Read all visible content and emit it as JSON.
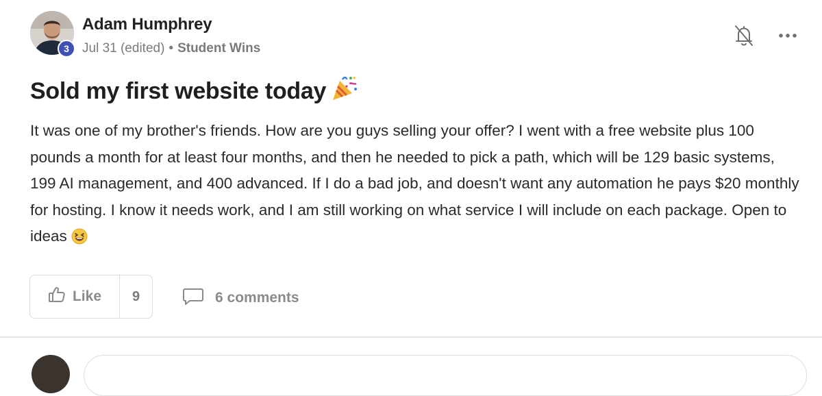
{
  "post": {
    "author": {
      "name": "Adam Humphrey",
      "level": "3"
    },
    "meta": {
      "date": "Jul 31 (edited)",
      "separator": "•",
      "category": "Student Wins"
    },
    "title": "Sold my first website today",
    "title_emoji": "party-popper-icon",
    "body": "It was one of my brother's friends. How are you guys selling your offer? I went with a free website plus 100 pounds a month for at least four months, and then he needed to pick a path, which will be 129 basic systems, 199 AI management, and 400 advanced. If I do a bad job, and doesn't want any automation he pays $20 monthly for hosting. I know it needs work, and I am still working on what service I will include on each package. Open to ideas",
    "body_emoji": "laughing-face-icon",
    "actions": {
      "like_label": "Like",
      "like_count": "9",
      "comments_label": "6 comments"
    }
  },
  "colors": {
    "level_badge": "#3f51b5",
    "muted_text": "#8a8a8a",
    "border": "#dcdcdc"
  }
}
